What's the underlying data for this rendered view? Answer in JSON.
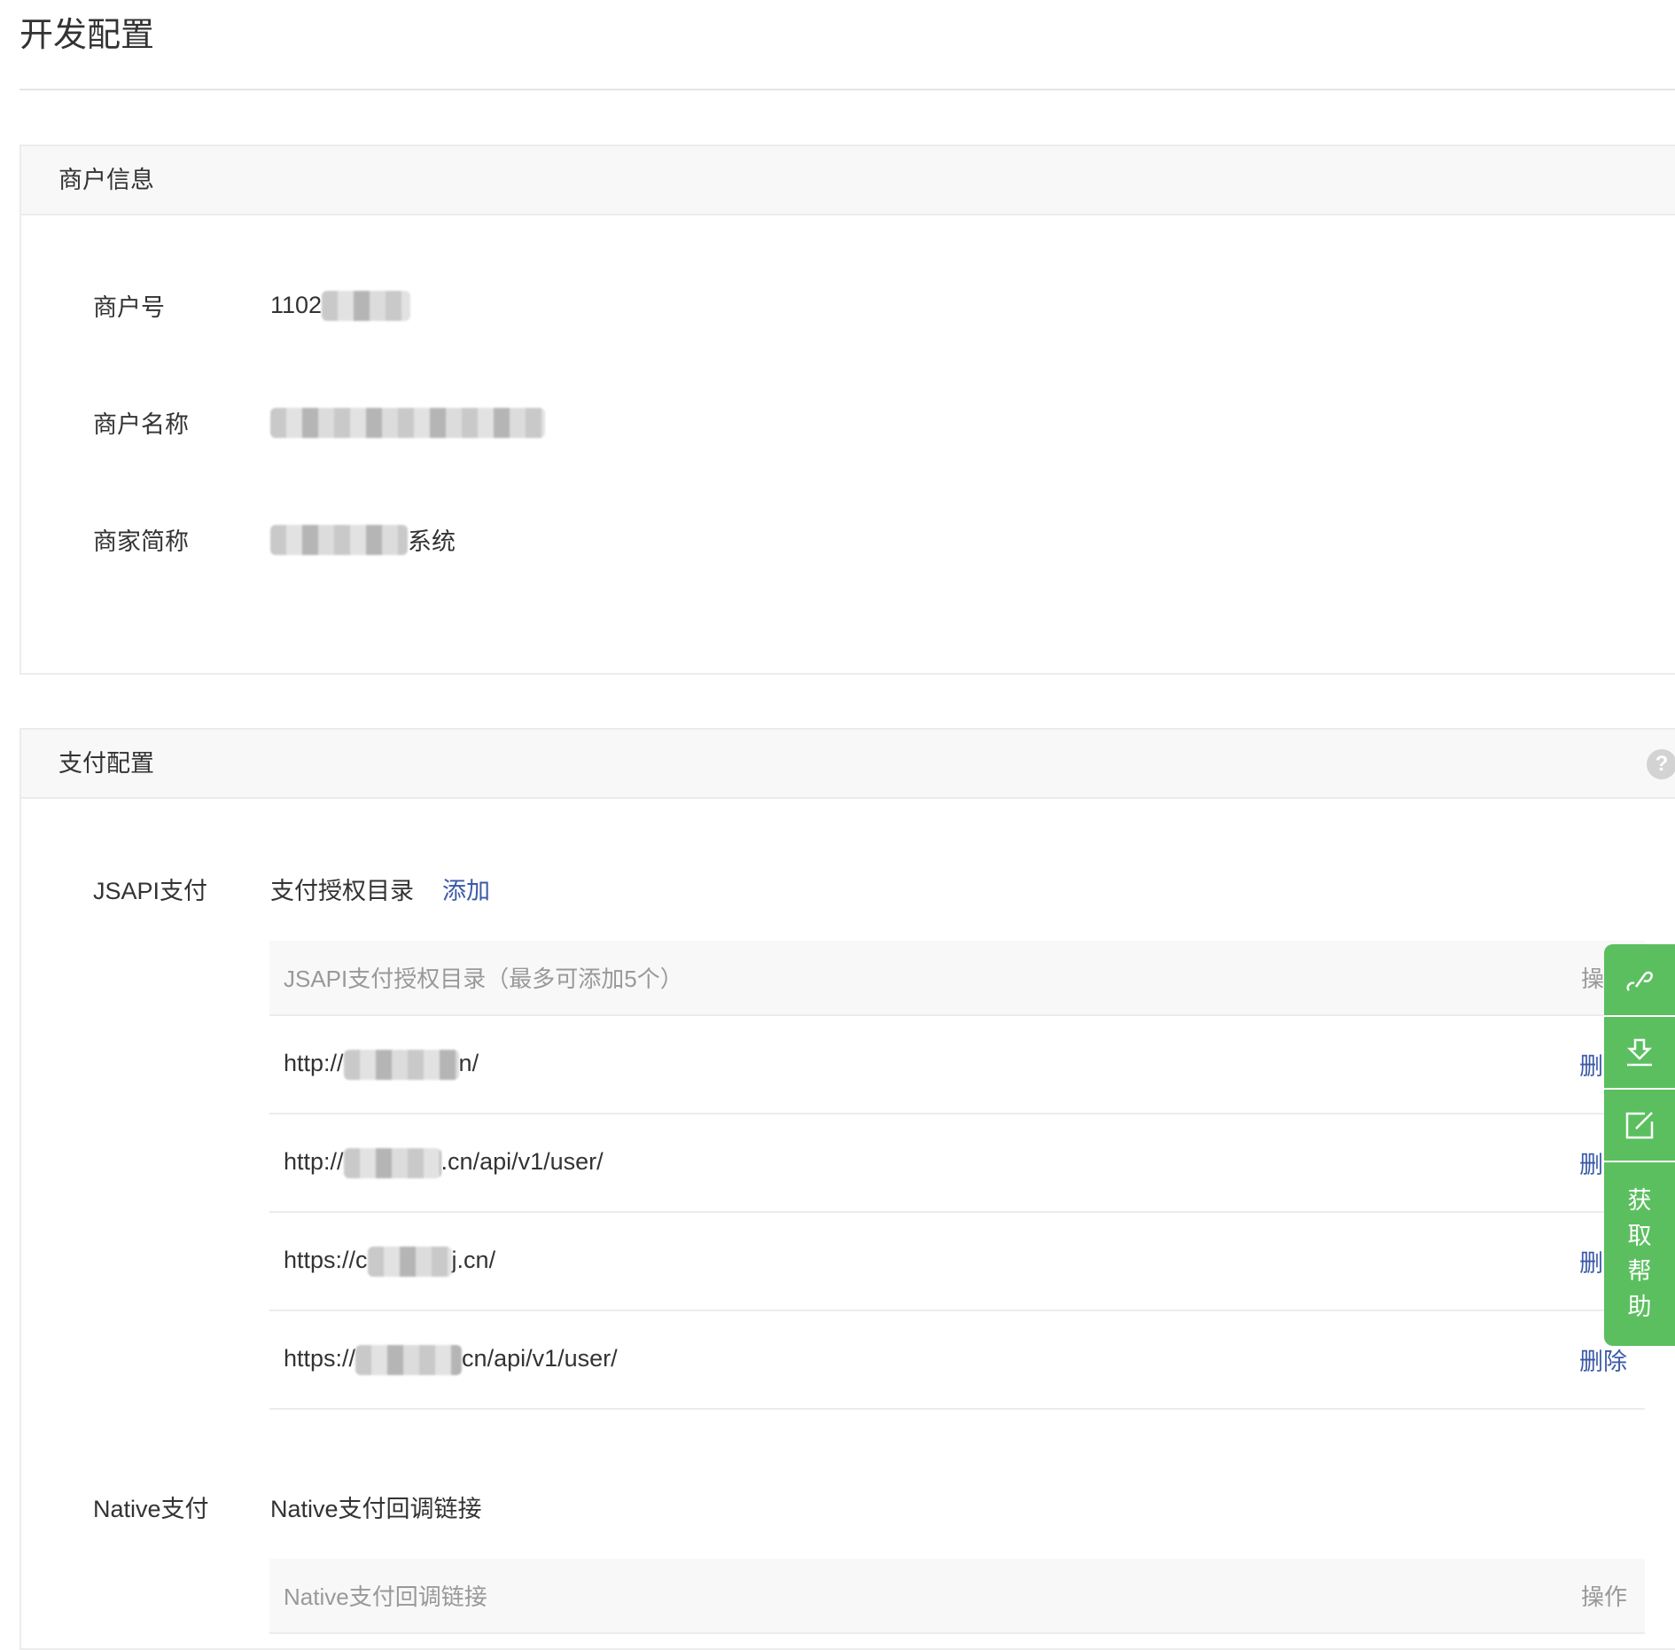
{
  "page_title": "开发配置",
  "merchant_card": {
    "title": "商户信息",
    "rows": [
      {
        "label": "商户号",
        "prefix": "1102",
        "suffix": ""
      },
      {
        "label": "商户名称",
        "prefix": "",
        "suffix": ""
      },
      {
        "label": "商家简称",
        "prefix": "",
        "suffix": "系统"
      }
    ]
  },
  "pay_card": {
    "title": "支付配置",
    "help_icon": "?",
    "jsapi": {
      "label": "JSAPI支付",
      "sub_label": "支付授权目录",
      "add_link": "添加",
      "table": {
        "header": "JSAPI支付授权目录（最多可添加5个）",
        "action_header": "操作",
        "rows": [
          {
            "prefix": "http://",
            "suffix": "n/",
            "action": "删除"
          },
          {
            "prefix": "http://",
            "suffix": ".cn/api/v1/user/",
            "action": "删除"
          },
          {
            "prefix": "https://c",
            "suffix": "j.cn/",
            "action": "删除"
          },
          {
            "prefix": "https://",
            "suffix": "cn/api/v1/user/",
            "action": "删除"
          }
        ]
      }
    },
    "native": {
      "label": "Native支付",
      "sub_label": "Native支付回调链接",
      "table": {
        "header": "Native支付回调链接",
        "action_header": "操作"
      }
    }
  },
  "side_toolbar": {
    "help_label": [
      "获",
      "取",
      "帮",
      "助"
    ]
  },
  "colors": {
    "accent": "#3b5aa8",
    "green": "#5bbf5f"
  }
}
